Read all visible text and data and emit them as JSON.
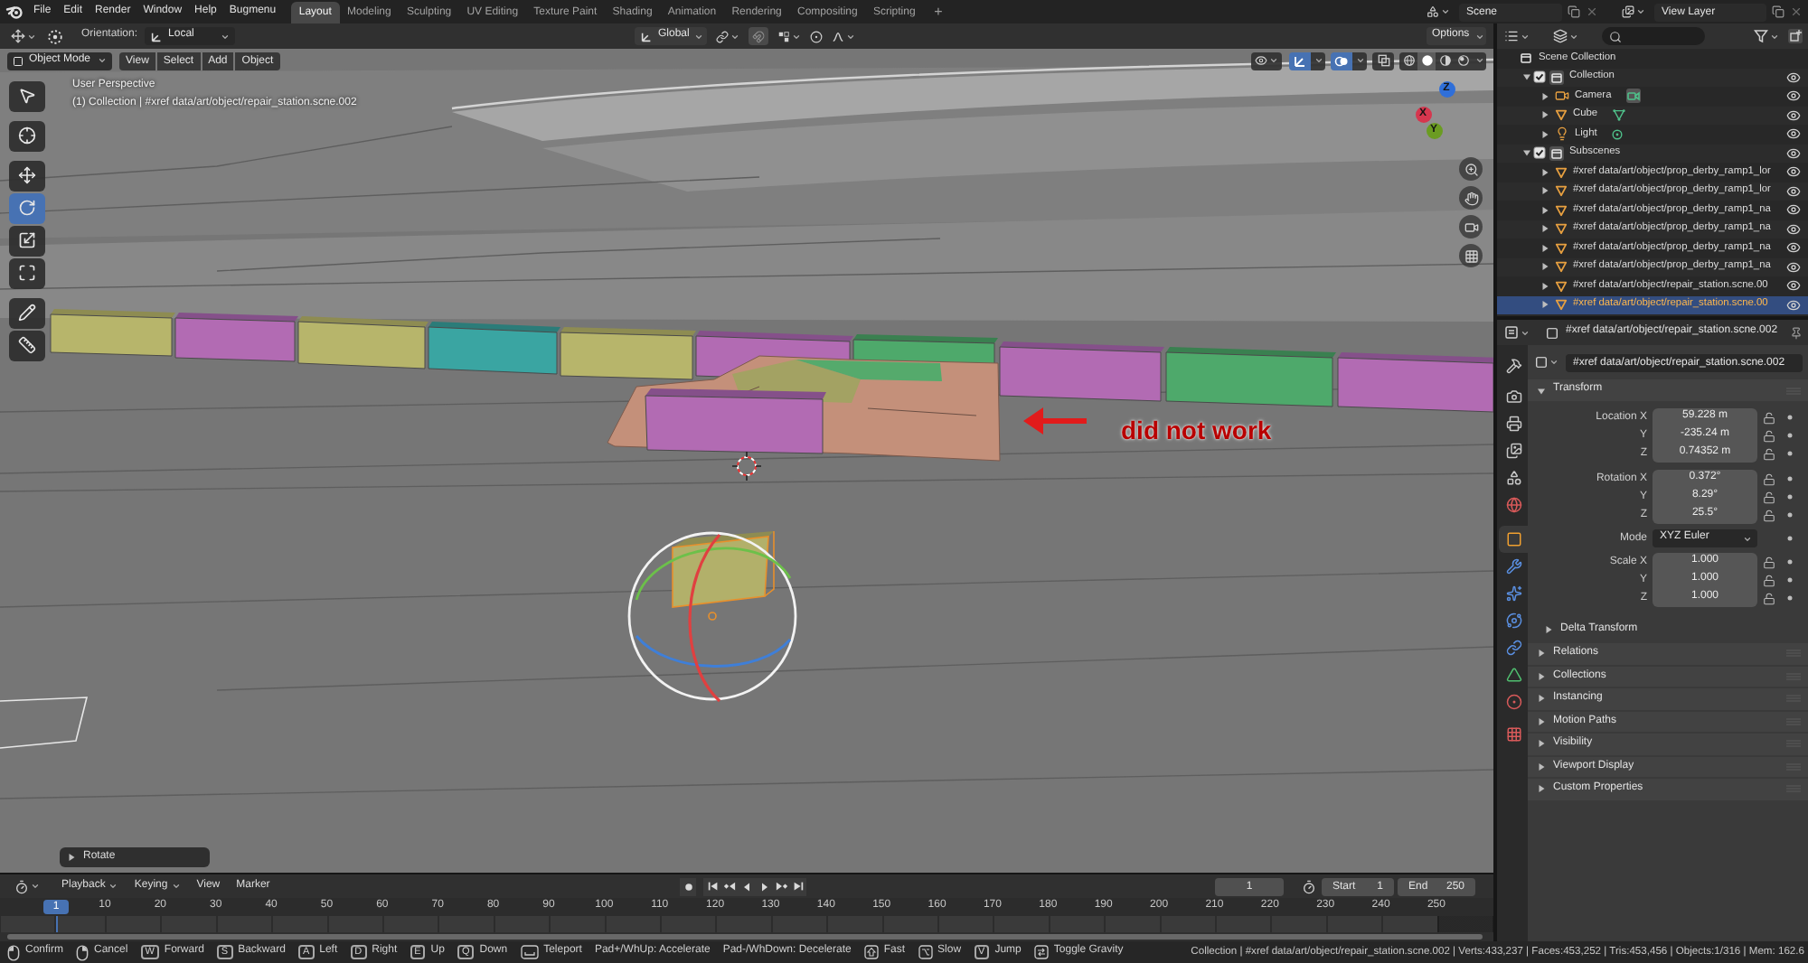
{
  "top_bar": {
    "menu": [
      "File",
      "Edit",
      "Render",
      "Window",
      "Help",
      "Bugmenu"
    ],
    "workspaces": [
      {
        "label": "Layout",
        "selected": true
      },
      {
        "label": "Modeling",
        "selected": false
      },
      {
        "label": "Sculpting",
        "selected": false
      },
      {
        "label": "UV Editing",
        "selected": false
      },
      {
        "label": "Texture Paint",
        "selected": false
      },
      {
        "label": "Shading",
        "selected": false
      },
      {
        "label": "Animation",
        "selected": false
      },
      {
        "label": "Rendering",
        "selected": false
      },
      {
        "label": "Compositing",
        "selected": false
      },
      {
        "label": "Scripting",
        "selected": false
      }
    ],
    "add_workspace": "+",
    "scene": "Scene",
    "view_layer": "View Layer"
  },
  "viewport": {
    "tool_header": {
      "orientation_label": "Orientation:",
      "orientation": "Local",
      "transform_orientation": "Global",
      "snap": false,
      "options": "Options"
    },
    "mode": "Object Mode",
    "menus": [
      "View",
      "Select",
      "Add",
      "Object"
    ],
    "toggles": [
      {
        "kind": "gizmos",
        "on": true
      },
      {
        "kind": "overlays",
        "on": true
      },
      {
        "kind": "xray",
        "on": false
      }
    ],
    "shading": [
      {
        "kind": "wireframe",
        "selected": false
      },
      {
        "kind": "solid",
        "selected": true
      },
      {
        "kind": "material",
        "selected": false
      },
      {
        "kind": "rendered",
        "selected": false
      }
    ],
    "info": [
      "User Perspective",
      "(1) Collection | #xref data/art/object/repair_station.scne.002"
    ],
    "tools": [
      {
        "kind": "select",
        "selected": false
      },
      {
        "kind": "cursor",
        "selected": false
      },
      {
        "kind": "move",
        "selected": false
      },
      {
        "kind": "rotate",
        "selected": true
      },
      {
        "kind": "scale",
        "selected": false
      },
      {
        "kind": "transform",
        "selected": false
      },
      {
        "kind": "annotate",
        "selected": false
      },
      {
        "kind": "measure",
        "selected": false
      }
    ],
    "axes": [
      {
        "label": "Z",
        "color": "#2f6fd9"
      },
      {
        "label": "X",
        "color": "#d6364e"
      },
      {
        "label": "Y",
        "color": "#6b9c22"
      }
    ],
    "annotation": "did not work",
    "last_operator": {
      "label": "Rotate",
      "expanded": false
    }
  },
  "outliner": {
    "tree": [
      {
        "label": "Scene Collection",
        "kind": "scene_collection",
        "selected": false,
        "children": [
          {
            "label": "Collection",
            "kind": "collection",
            "checked": true,
            "expanded": true,
            "visible": true,
            "selected": false,
            "children": [
              {
                "label": "Camera",
                "kind": "camera",
                "expanded": false,
                "visible": true,
                "selected": false
              },
              {
                "label": "Cube",
                "kind": "mesh",
                "expanded": false,
                "visible": true,
                "selected": false
              },
              {
                "label": "Light",
                "kind": "light",
                "expanded": false,
                "visible": true,
                "selected": false
              }
            ]
          },
          {
            "label": "Subscenes",
            "kind": "collection",
            "checked": true,
            "expanded": true,
            "visible": true,
            "selected": false,
            "children": [
              {
                "label": "#xref data/art/object/prop_derby_ramp1_lor",
                "kind": "xref",
                "expanded": false,
                "visible": true,
                "selected": false
              },
              {
                "label": "#xref data/art/object/prop_derby_ramp1_lor",
                "kind": "xref",
                "expanded": false,
                "visible": true,
                "selected": false
              },
              {
                "label": "#xref data/art/object/prop_derby_ramp1_na",
                "kind": "xref",
                "expanded": false,
                "visible": true,
                "selected": false
              },
              {
                "label": "#xref data/art/object/prop_derby_ramp1_na",
                "kind": "xref",
                "expanded": false,
                "visible": true,
                "selected": false
              },
              {
                "label": "#xref data/art/object/prop_derby_ramp1_na",
                "kind": "xref",
                "expanded": false,
                "visible": true,
                "selected": false
              },
              {
                "label": "#xref data/art/object/prop_derby_ramp1_na",
                "kind": "xref",
                "expanded": false,
                "visible": true,
                "selected": false
              },
              {
                "label": "#xref data/art/object/repair_station.scne.00",
                "kind": "xref",
                "expanded": false,
                "visible": true,
                "selected": false
              },
              {
                "label": "#xref data/art/object/repair_station.scne.00",
                "kind": "xref",
                "expanded": false,
                "visible": true,
                "selected": true
              }
            ]
          }
        ]
      }
    ]
  },
  "properties": {
    "context": "#xref data/art/object/repair_station.scne.002",
    "tabs": [
      {
        "kind": "tool",
        "selected": false
      },
      {
        "kind": "render",
        "selected": false
      },
      {
        "kind": "output",
        "selected": false
      },
      {
        "kind": "view_layer",
        "selected": false
      },
      {
        "kind": "scene",
        "selected": false
      },
      {
        "kind": "world",
        "selected": false
      },
      {
        "kind": "object",
        "selected": true
      },
      {
        "kind": "modifiers",
        "selected": false
      },
      {
        "kind": "particles",
        "selected": false
      },
      {
        "kind": "physics",
        "selected": false
      },
      {
        "kind": "constraints",
        "selected": false
      },
      {
        "kind": "data",
        "selected": false
      },
      {
        "kind": "material",
        "selected": false
      },
      {
        "kind": "texture",
        "selected": false
      }
    ],
    "name": "#xref data/art/object/repair_station.scne.002",
    "transform": {
      "title": "Transform",
      "expanded": true,
      "groups": [
        {
          "kind": "vector",
          "rows": [
            {
              "label": "Location X",
              "value": "59.228 m",
              "locked": false
            },
            {
              "label": "Y",
              "value": "-235.24 m",
              "locked": false
            },
            {
              "label": "Z",
              "value": "0.74352 m",
              "locked": false
            }
          ]
        },
        {
          "kind": "vector",
          "rows": [
            {
              "label": "Rotation X",
              "value": "0.372°",
              "locked": false
            },
            {
              "label": "Y",
              "value": "8.29°",
              "locked": false
            },
            {
              "label": "Z",
              "value": "25.5°",
              "locked": false
            }
          ]
        },
        {
          "kind": "dropdown",
          "label": "Mode",
          "value": "XYZ Euler"
        },
        {
          "kind": "vector",
          "rows": [
            {
              "label": "Scale X",
              "value": "1.000",
              "locked": false
            },
            {
              "label": "Y",
              "value": "1.000",
              "locked": false
            },
            {
              "label": "Z",
              "value": "1.000",
              "locked": false
            }
          ]
        }
      ],
      "subpanels": [
        {
          "title": "Delta Transform",
          "expanded": false
        }
      ]
    },
    "panels": [
      {
        "title": "Relations",
        "expanded": false
      },
      {
        "title": "Collections",
        "expanded": false
      },
      {
        "title": "Instancing",
        "expanded": false
      },
      {
        "title": "Motion Paths",
        "expanded": false
      },
      {
        "title": "Visibility",
        "expanded": false
      },
      {
        "title": "Viewport Display",
        "expanded": false
      },
      {
        "title": "Custom Properties",
        "expanded": false
      }
    ]
  },
  "timeline": {
    "menus": [
      {
        "label": "Playback",
        "kind": "dropdown"
      },
      {
        "label": "Keying",
        "kind": "dropdown"
      },
      {
        "label": "View",
        "kind": "menu"
      },
      {
        "label": "Marker",
        "kind": "menu"
      }
    ],
    "controls": [
      {
        "kind": "record"
      },
      {
        "kind": "jump_start"
      },
      {
        "kind": "prev_key"
      },
      {
        "kind": "play_reverse"
      },
      {
        "kind": "play"
      },
      {
        "kind": "next_key"
      },
      {
        "kind": "jump_end"
      }
    ],
    "current_frame": "1",
    "preview_range": false,
    "start": {
      "label": "Start",
      "value": "1"
    },
    "end": {
      "label": "End",
      "value": "250"
    },
    "playhead": "1",
    "ruler": [
      "10",
      "20",
      "30",
      "40",
      "50",
      "60",
      "70",
      "80",
      "90",
      "100",
      "110",
      "120",
      "130",
      "140",
      "150",
      "160",
      "170",
      "180",
      "190",
      "200",
      "210",
      "220",
      "230",
      "240",
      "250"
    ]
  },
  "status_bar": {
    "hints": [
      {
        "kind": "mouse_left",
        "label": "Confirm"
      },
      {
        "kind": "mouse_right",
        "label": "Cancel"
      },
      {
        "kind": "key",
        "key": "W",
        "label": "Forward"
      },
      {
        "kind": "key",
        "key": "S",
        "label": "Backward"
      },
      {
        "kind": "key",
        "key": "A",
        "label": "Left"
      },
      {
        "kind": "key",
        "key": "D",
        "label": "Right"
      },
      {
        "kind": "key",
        "key": "E",
        "label": "Up"
      },
      {
        "kind": "key",
        "key": "Q",
        "label": "Down"
      },
      {
        "kind": "space",
        "label": "Teleport"
      },
      {
        "kind": "text",
        "label": "Pad+/WhUp: Accelerate"
      },
      {
        "kind": "text",
        "label": "Pad-/WhDown: Decelerate"
      },
      {
        "kind": "shift",
        "label": "Fast"
      },
      {
        "kind": "alt",
        "label": "Slow"
      },
      {
        "kind": "key",
        "key": "V",
        "label": "Jump"
      },
      {
        "kind": "tab",
        "label": "Toggle Gravity"
      }
    ],
    "stats": "Collection | #xref data/art/object/repair_station.scne.002 | Verts:433,237 | Faces:453,252 | Tris:453,456 | Objects:1/316 | Mem: 162.6"
  }
}
